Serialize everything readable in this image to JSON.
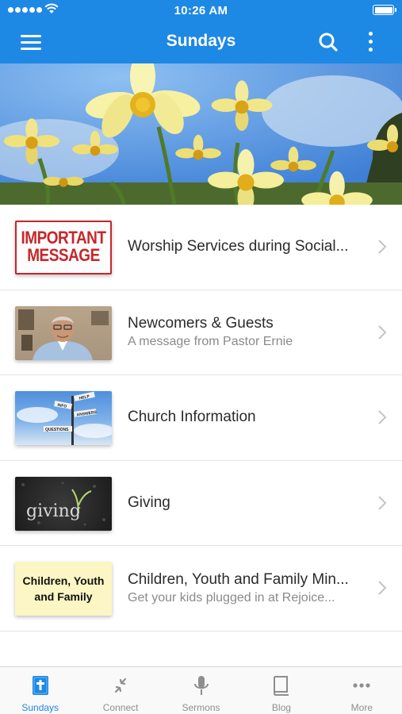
{
  "status_bar": {
    "time": "10:26 AM"
  },
  "header": {
    "title": "Sundays"
  },
  "list": [
    {
      "title": "Worship Services during Social...",
      "subtitle": "",
      "thumb_text": [
        "IMPORTANT",
        "MESSAGE"
      ]
    },
    {
      "title": "Newcomers & Guests",
      "subtitle": "A message from Pastor Ernie"
    },
    {
      "title": "Church Information",
      "subtitle": "",
      "thumb_text": [
        "HELP",
        "QUESTIONS",
        "ANSWERS",
        "INFO"
      ]
    },
    {
      "title": "Giving",
      "subtitle": "",
      "thumb_text": "giving"
    },
    {
      "title": "Children, Youth and Family Min...",
      "subtitle": "Get your kids plugged in at Rejoice...",
      "thumb_text": [
        "Children, Youth",
        "and Family"
      ]
    }
  ],
  "tabs": [
    {
      "label": "Sundays",
      "icon": "bible-icon",
      "active": true
    },
    {
      "label": "Connect",
      "icon": "connect-arrows-icon",
      "active": false
    },
    {
      "label": "Sermons",
      "icon": "microphone-icon",
      "active": false
    },
    {
      "label": "Blog",
      "icon": "book-icon",
      "active": false
    },
    {
      "label": "More",
      "icon": "more-dots-icon",
      "active": false
    }
  ],
  "colors": {
    "accent": "#1e88e5",
    "tab_inactive": "#8e8e8e",
    "divider": "#e4e4e4"
  }
}
